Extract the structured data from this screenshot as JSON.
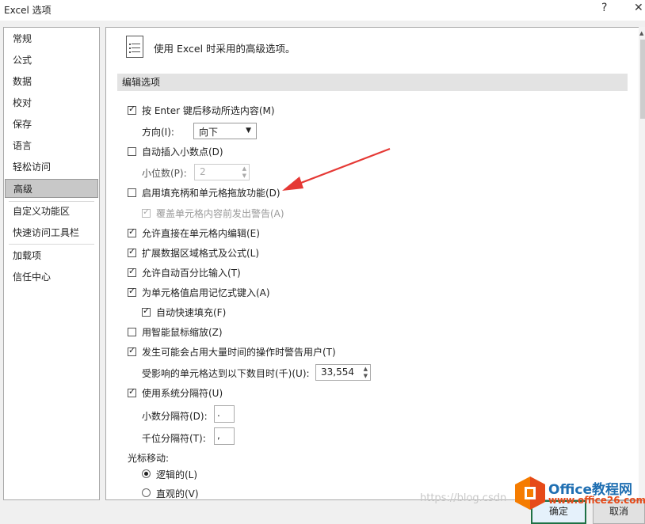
{
  "window": {
    "title": "Excel 选项",
    "help_glyph": "?",
    "close_glyph": "✕"
  },
  "sidebar": {
    "items": [
      {
        "label": "常规"
      },
      {
        "label": "公式"
      },
      {
        "label": "数据"
      },
      {
        "label": "校对"
      },
      {
        "label": "保存"
      },
      {
        "label": "语言"
      },
      {
        "label": "轻松访问"
      },
      {
        "label": "高级",
        "active": true
      },
      {
        "label": "自定义功能区"
      },
      {
        "label": "快速访问工具栏"
      },
      {
        "label": "加载项"
      },
      {
        "label": "信任中心"
      }
    ]
  },
  "main": {
    "page_title": "使用 Excel 时采用的高级选项。",
    "section_header": "编辑选项",
    "options": {
      "enter_move": {
        "label": "按 Enter 键后移动所选内容(M)",
        "checked": true
      },
      "direction_label": "方向(I):",
      "direction_value": "向下",
      "auto_decimal": {
        "label": "自动插入小数点(D)",
        "checked": false
      },
      "places_label": "小位数(P):",
      "places_value": "2",
      "fill_handle": {
        "label": "启用填充柄和单元格拖放功能(D)",
        "checked": false
      },
      "alert_overwrite": {
        "label": "覆盖单元格内容前发出警告(A)",
        "checked": true,
        "disabled": true
      },
      "edit_in_cell": {
        "label": "允许直接在单元格内编辑(E)",
        "checked": true
      },
      "extend_formats": {
        "label": "扩展数据区域格式及公式(L)",
        "checked": true
      },
      "auto_percent": {
        "label": "允许自动百分比输入(T)",
        "checked": true
      },
      "autocomplete": {
        "label": "为单元格值启用记忆式键入(A)",
        "checked": true
      },
      "flash_fill": {
        "label": "自动快速填充(F)",
        "checked": true
      },
      "zoom_roll": {
        "label": "用智能鼠标缩放(Z)",
        "checked": false
      },
      "alert_slow": {
        "label": "发生可能会占用大量时间的操作时警告用户(T)",
        "checked": true
      },
      "cells_label": "受影响的单元格达到以下数目时(千)(U):",
      "cells_value": "33,554",
      "system_sep": {
        "label": "使用系统分隔符(U)",
        "checked": true
      },
      "decimal_sep_label": "小数分隔符(D):",
      "decimal_sep_value": ".",
      "thousands_sep_label": "千位分隔符(T):",
      "thousands_sep_value": ",",
      "cursor_label": "光标移动:",
      "logical": {
        "label": "逻辑的(L)",
        "checked": true
      },
      "visual": {
        "label": "直观的(V)",
        "checked": false
      }
    }
  },
  "buttons": {
    "ok": "确定",
    "cancel": "取消"
  },
  "watermark": {
    "url": "https://blog.csdn",
    "brand": "Office教程网",
    "site": "www.office26.com"
  },
  "colors": {
    "annotation_arrow": "#e53935",
    "logo_orange": "#f57c00",
    "logo_red": "#e64a19"
  }
}
